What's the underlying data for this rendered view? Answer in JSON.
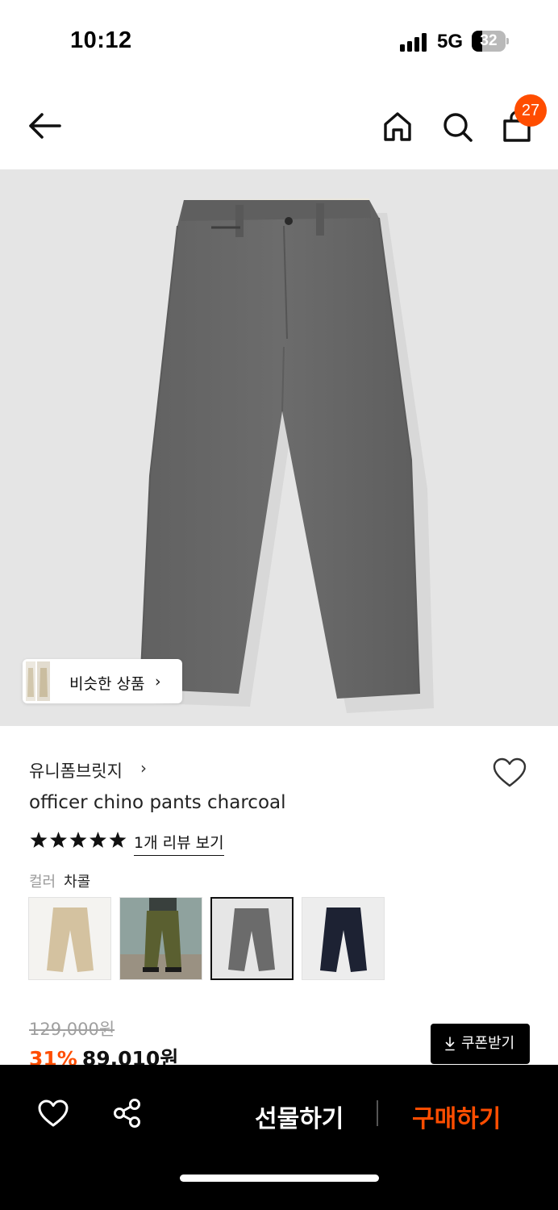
{
  "status_bar": {
    "time": "10:12",
    "network": "5G",
    "battery_level": "32",
    "battery_fraction": 0.32
  },
  "header": {
    "back_icon": "arrow-left-icon",
    "home_icon": "home-icon",
    "search_icon": "search-icon",
    "cart_icon": "shopping-bag-icon",
    "cart_count": "27",
    "badge_color": "#ff4d00"
  },
  "hero": {
    "similar_products_label": "비슷한 상품",
    "similar_chevron": "›"
  },
  "product": {
    "brand": "유니폼브릿지",
    "brand_chevron": "›",
    "title": "officer chino pants charcoal",
    "rating_stars": 5,
    "review_link": "1개 리뷰 보기",
    "color_label": "컬러",
    "color_value": "차콜",
    "swatches": [
      {
        "name": "beige",
        "color": "#d4c2a0",
        "selected": false
      },
      {
        "name": "olive",
        "color": "#5a5f30",
        "selected": false
      },
      {
        "name": "charcoal",
        "color": "#6b6b6b",
        "selected": true
      },
      {
        "name": "navy",
        "color": "#1d2233",
        "selected": false
      }
    ]
  },
  "price": {
    "original": "129,000원",
    "discount": "31%",
    "sale": "89,010원",
    "coupon_button": "쿠폰받기",
    "accent_color": "#ff4d00"
  },
  "bottom_bar": {
    "gift_label": "선물하기",
    "buy_label": "구매하기"
  }
}
